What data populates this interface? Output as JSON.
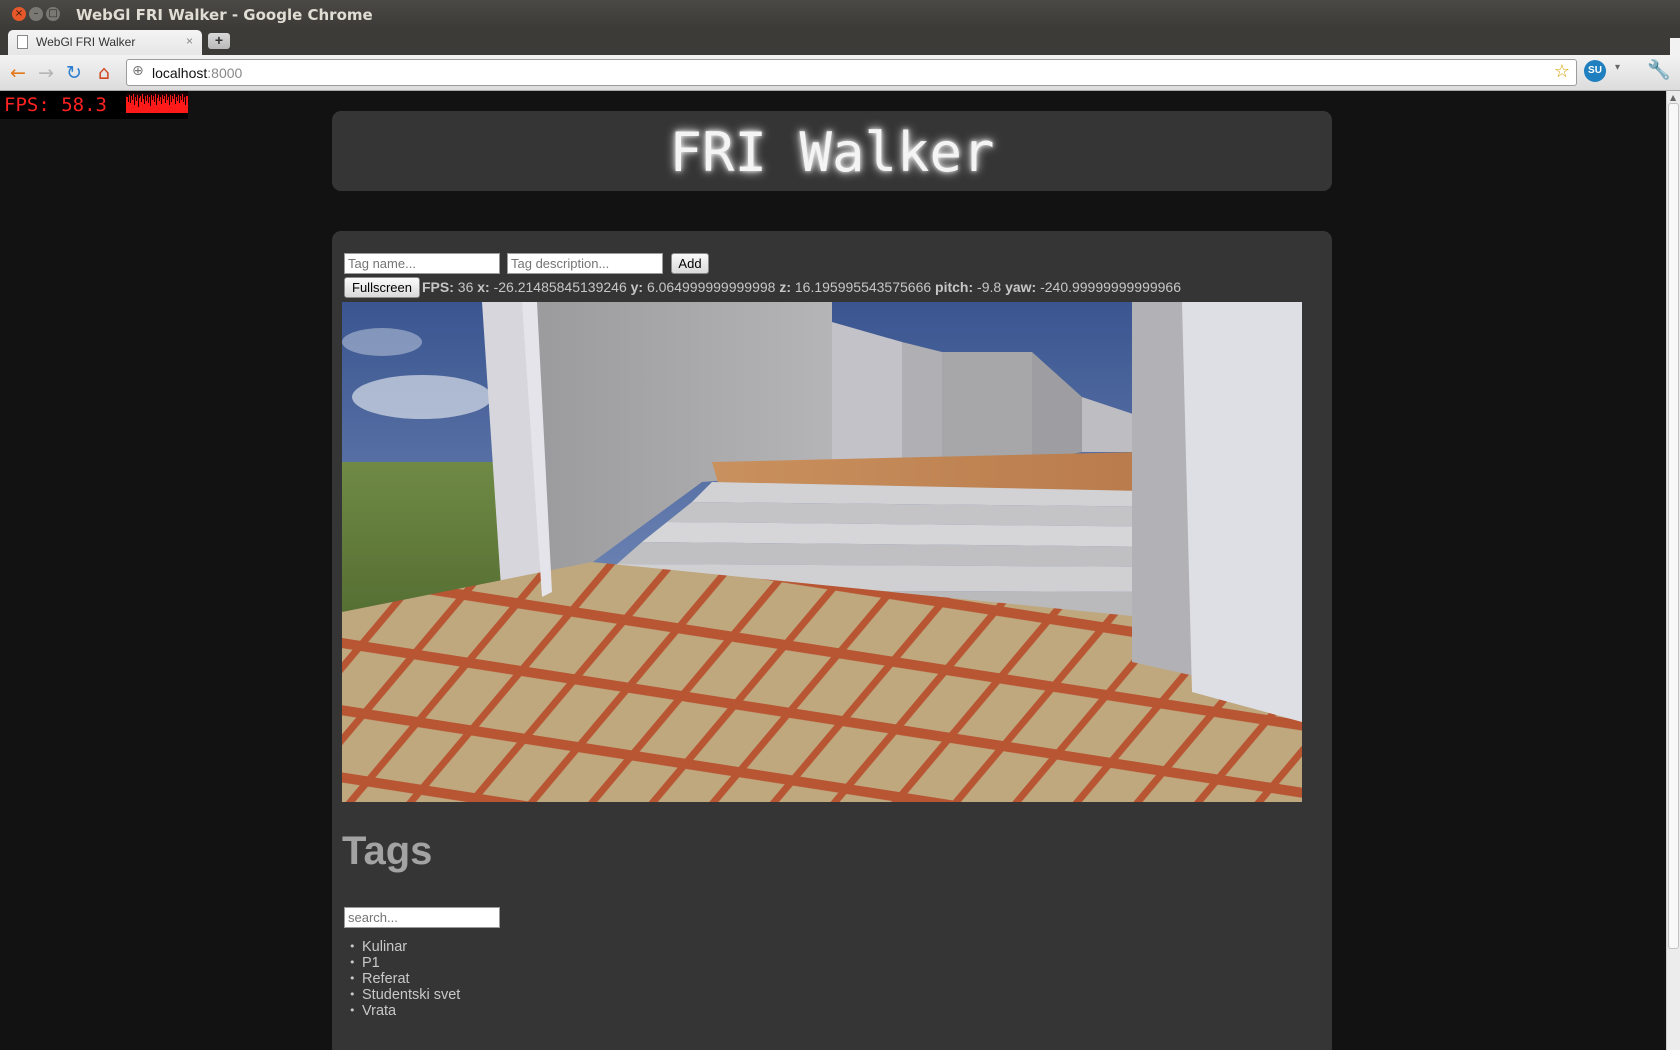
{
  "window": {
    "title": "WebGl FRI Walker - Google Chrome",
    "close_glyph": "×",
    "min_glyph": "–",
    "max_glyph": "□"
  },
  "tab": {
    "label": "WebGl FRI Walker",
    "close": "×",
    "new_tab": "+"
  },
  "toolbar": {
    "back_icon": "←",
    "forward_icon": "→",
    "reload_icon": "↻",
    "home_icon": "⌂",
    "url_host": "localhost",
    "url_port": ":8000",
    "star_icon": "☆",
    "stumbleupon": "SU",
    "menu_arrow": "▾",
    "wrench_icon": "🔧"
  },
  "stats": {
    "label": "FPS:  58.3",
    "color": "#ff2222"
  },
  "site": {
    "title": "FRI Walker"
  },
  "tag_form": {
    "name_placeholder": "Tag name...",
    "description_placeholder": "Tag description...",
    "add_label": "Add"
  },
  "controls": {
    "fullscreen_label": "Fullscreen"
  },
  "status": {
    "fps_label": "FPS:",
    "fps": "36",
    "x_label": "x:",
    "x": "-26.21485845139246",
    "y_label": "y:",
    "y": "6.064999999999998",
    "z_label": "z:",
    "z": "16.195995543575666",
    "pitch_label": "pitch:",
    "pitch": "-9.8",
    "yaw_label": "yaw:",
    "yaw": "-240.99999999999966"
  },
  "tags": {
    "heading": "Tags",
    "search_placeholder": "search...",
    "items": [
      "Kulinar",
      "P1",
      "Referat",
      "Studentski svet",
      "Vrata"
    ]
  },
  "colors": {
    "page_bg": "#121212",
    "panel_bg": "#353535",
    "title_glow": "#ffffff"
  }
}
